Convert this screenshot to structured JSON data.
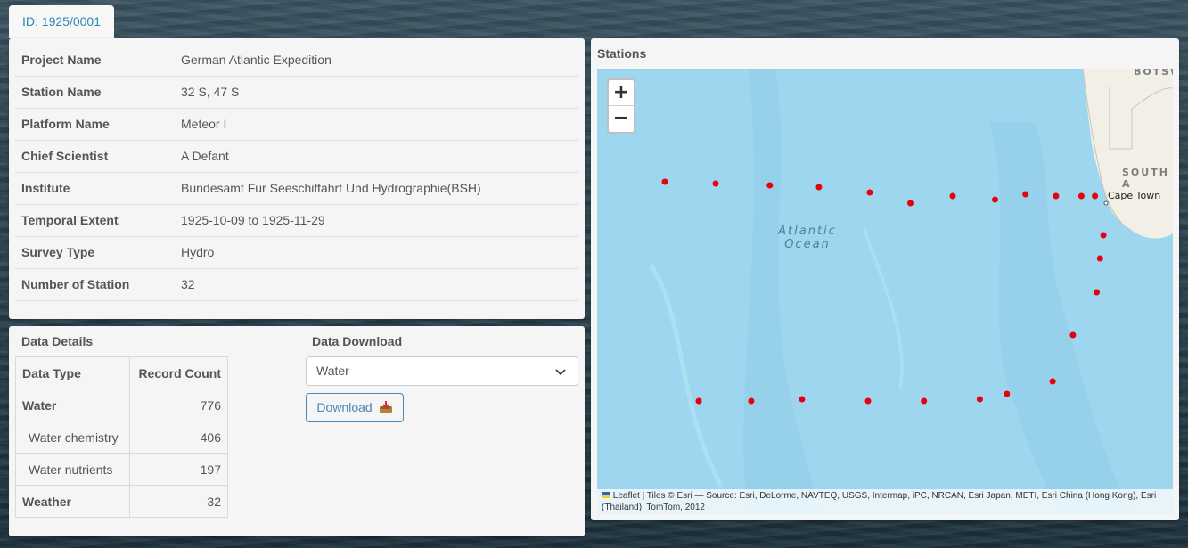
{
  "header": {
    "id_tab": "ID: 1925/0001"
  },
  "info": [
    {
      "label": "Project Name",
      "value": "German Atlantic Expedition"
    },
    {
      "label": "Station Name",
      "value": "32 S, 47 S"
    },
    {
      "label": "Platform Name",
      "value": "Meteor I"
    },
    {
      "label": "Chief Scientist",
      "value": "A Defant"
    },
    {
      "label": "Institute",
      "value": "Bundesamt Fur Seeschiffahrt Und Hydrographie(BSH)"
    },
    {
      "label": "Temporal Extent",
      "value": "1925-10-09 to 1925-11-29"
    },
    {
      "label": "Survey Type",
      "value": "Hydro"
    },
    {
      "label": "Number of Station",
      "value": "32"
    }
  ],
  "details": {
    "title": "Data Details",
    "columns": [
      "Data Type",
      "Record Count"
    ],
    "rows": [
      {
        "name": "Water",
        "count": "776",
        "level": "parent"
      },
      {
        "name": "Water chemistry",
        "count": "406",
        "level": "child"
      },
      {
        "name": "Water nutrients",
        "count": "197",
        "level": "child"
      },
      {
        "name": "Weather",
        "count": "32",
        "level": "parent"
      }
    ]
  },
  "download": {
    "title": "Data Download",
    "selected": "Water",
    "button_label": "Download",
    "button_icon": "inbox-tray-icon"
  },
  "map": {
    "title": "Stations",
    "zoom_in": "+",
    "zoom_out": "−",
    "ocean_label_line1": "Atlantic",
    "ocean_label_line2": "Ocean",
    "country_label_1": "BOTSW",
    "country_label_2": "SOUTH A",
    "city_label": "Cape Town",
    "attribution": "Leaflet | Tiles © Esri — Source: Esri, DeLorme, NAVTEQ, USGS, Intermap, iPC, NRCAN, Esri Japan, METI, Esri China (Hong Kong), Esri (Thailand), TomTom, 2012",
    "marker_color": "#e8000b",
    "stations": [
      {
        "lat": -32.0,
        "lon": -6.5
      },
      {
        "lat": -32.1,
        "lon": -3.5
      },
      {
        "lat": -32.2,
        "lon": -0.3
      },
      {
        "lat": -32.3,
        "lon": 2.6
      },
      {
        "lat": -32.6,
        "lon": 5.6
      },
      {
        "lat": -33.2,
        "lon": 8.0
      },
      {
        "lat": -32.8,
        "lon": 10.5
      },
      {
        "lat": -33.0,
        "lon": 13.0
      },
      {
        "lat": -32.7,
        "lon": 14.8
      },
      {
        "lat": -32.8,
        "lon": 16.6
      },
      {
        "lat": -32.8,
        "lon": 18.1
      },
      {
        "lat": -32.8,
        "lon": 18.9
      },
      {
        "lat": -35.0,
        "lon": 19.4
      },
      {
        "lat": -36.3,
        "lon": 19.2
      },
      {
        "lat": -38.2,
        "lon": 19.0
      },
      {
        "lat": -40.6,
        "lon": 17.6
      },
      {
        "lat": -43.2,
        "lon": 16.4
      },
      {
        "lat": -43.9,
        "lon": 13.7
      },
      {
        "lat": -44.2,
        "lon": 12.1
      },
      {
        "lat": -44.3,
        "lon": 8.8
      },
      {
        "lat": -44.3,
        "lon": 5.5
      },
      {
        "lat": -44.2,
        "lon": 1.6
      },
      {
        "lat": -44.3,
        "lon": -1.4
      },
      {
        "lat": -44.3,
        "lon": -4.5
      }
    ]
  }
}
